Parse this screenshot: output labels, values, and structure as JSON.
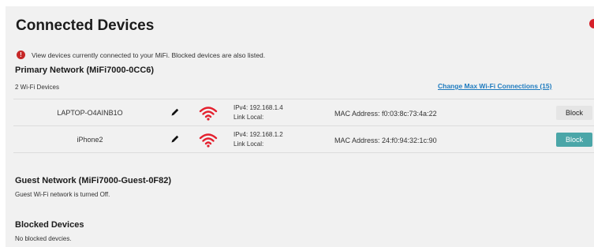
{
  "page": {
    "title": "Connected Devices",
    "info_text": "View devices currently connected to your MiFi. Blocked devices are also listed.",
    "info_icon": "!"
  },
  "primary": {
    "title": "Primary Network (MiFi7000-0CC6)",
    "count_label": "2 Wi-Fi Devices",
    "change_link": "Change Max Wi-Fi Connections (15)",
    "devices": [
      {
        "name": "LAPTOP-O4AINB1O",
        "ipv4": "IPv4: 192.168.1.4",
        "link_local": "Link Local:",
        "mac": "MAC Address: f0:03:8c:73:4a:22",
        "block_label": "Block"
      },
      {
        "name": "iPhone2",
        "ipv4": "IPv4: 192.168.1.2",
        "link_local": "Link Local:",
        "mac": "MAC Address: 24:f0:94:32:1c:90",
        "block_label": "Block"
      }
    ]
  },
  "guest": {
    "title": "Guest Network (MiFi7000-Guest-0F82)",
    "status": "Guest Wi-Fi network is turned Off."
  },
  "blocked": {
    "title": "Blocked Devices",
    "status": "No blocked devcies."
  },
  "colors": {
    "wifi_red": "#e4202e",
    "block_teal": "#4ba6a8",
    "link_blue": "#1e7bbf",
    "info_red": "#c62828"
  }
}
